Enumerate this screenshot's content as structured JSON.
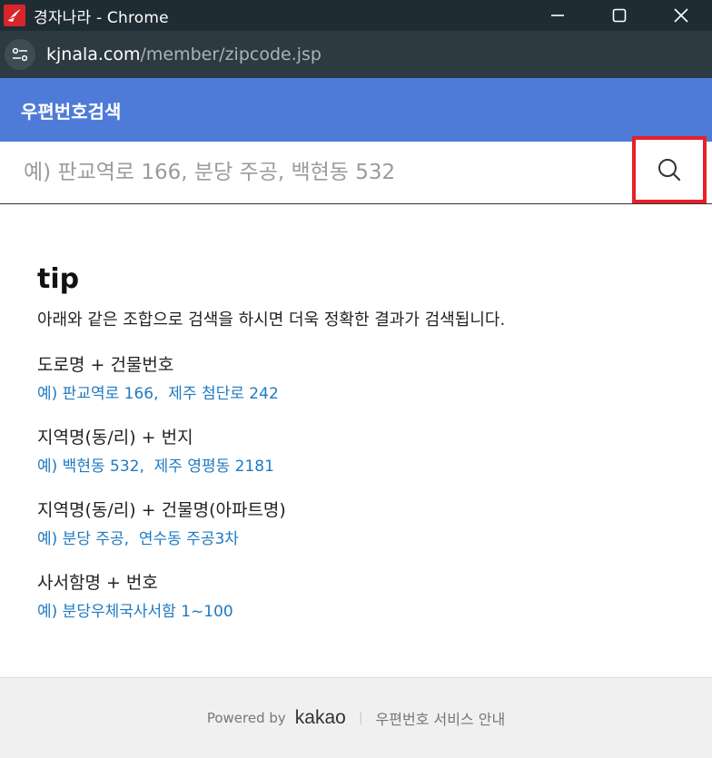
{
  "window": {
    "title": "경자나라 - Chrome"
  },
  "address": {
    "domain": "kjnala.com",
    "path": "/member/zipcode.jsp"
  },
  "header": {
    "title": "우편번호검색"
  },
  "search": {
    "placeholder": "예) 판교역로 166, 분당 주공, 백현동 532"
  },
  "tip": {
    "title": "tip",
    "description": "아래와 같은 조합으로 검색을 하시면 더욱 정확한 결과가 검색됩니다.",
    "items": [
      {
        "label": "도로명 + 건물번호",
        "example": "예) 판교역로 166,  제주 첨단로 242"
      },
      {
        "label": "지역명(동/리) + 번지",
        "example": "예) 백현동 532,  제주 영평동 2181"
      },
      {
        "label": "지역명(동/리) + 건물명(아파트명)",
        "example": "예) 분당 주공,  연수동 주공3차"
      },
      {
        "label": "사서함명 + 번호",
        "example": "예) 분당우체국사서함 1~100"
      }
    ]
  },
  "footer": {
    "powered_by": "Powered by",
    "brand": "kakao",
    "separator": "|",
    "service_link": "우편번호 서비스 안내"
  },
  "colors": {
    "header_bg": "#4f7bd8",
    "highlight_border": "#e8202a",
    "example_link": "#1f7ac2"
  },
  "icons": {
    "app": "kjnala-app-icon",
    "site_info": "tune-icon",
    "search": "search-icon"
  }
}
